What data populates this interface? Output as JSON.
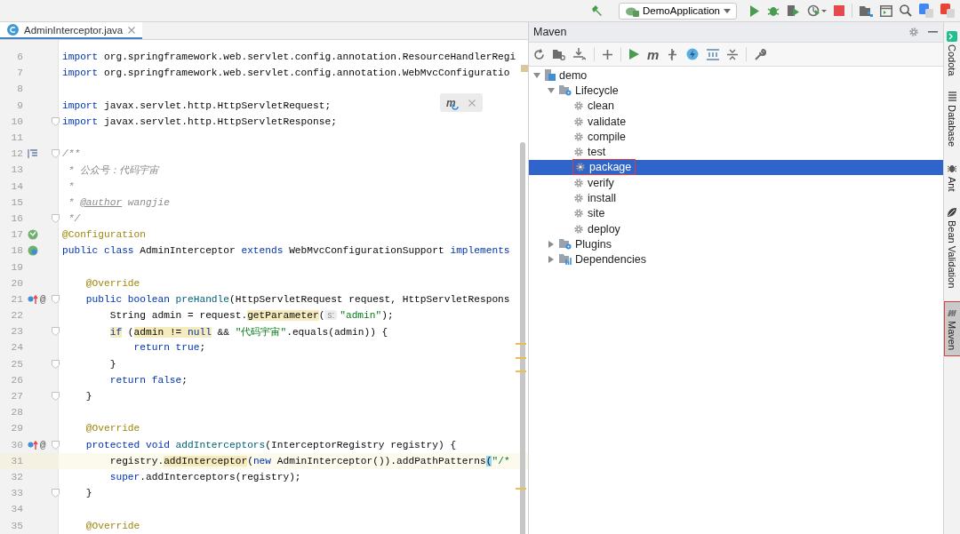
{
  "toolbar": {
    "run_config": "DemoApplication"
  },
  "editor": {
    "tabs": [
      {
        "label": "AdminInterceptor.java",
        "selected": true
      }
    ],
    "popup_label": "m",
    "lines": [
      {
        "number": "6",
        "kind": "plain",
        "current": false,
        "fold": false,
        "tokens": [
          {
            "text": "import",
            "kind": "kw",
            "highlighted": false
          },
          {
            "text": " org.springframework.web.servlet.config.annotation.ResourceHandlerRegi",
            "kind": "plain",
            "highlighted": false
          }
        ]
      },
      {
        "number": "7",
        "kind": "plain",
        "current": false,
        "fold": false,
        "tokens": [
          {
            "text": "import",
            "kind": "kw",
            "highlighted": false
          },
          {
            "text": " org.springframework.web.servlet.config.annotation.WebMvcConfiguratio",
            "kind": "plain",
            "highlighted": false
          }
        ]
      },
      {
        "number": "8",
        "kind": "plain",
        "current": false,
        "fold": false
      },
      {
        "number": "9",
        "kind": "plain",
        "current": false,
        "fold": false,
        "tokens": [
          {
            "text": "import",
            "kind": "kw",
            "highlighted": false
          },
          {
            "text": " javax.servlet.http.HttpServletRequest;",
            "kind": "plain",
            "highlighted": false
          }
        ]
      },
      {
        "number": "10",
        "kind": "plain",
        "current": false,
        "fold": true,
        "tokens": [
          {
            "text": "import",
            "kind": "kw",
            "highlighted": false
          },
          {
            "text": " javax.servlet.http.HttpServletResponse;",
            "kind": "plain",
            "highlighted": false
          }
        ]
      },
      {
        "number": "11",
        "kind": "plain",
        "current": false,
        "fold": false
      },
      {
        "number": "12",
        "kind": "doc",
        "current": false,
        "fold": true,
        "tokens": [
          {
            "text": "/**",
            "kind": "comment",
            "highlighted": false
          }
        ]
      },
      {
        "number": "13",
        "kind": "plain",
        "current": false,
        "fold": false,
        "tokens": [
          {
            "text": " * 公众号：代码宇宙",
            "kind": "comment",
            "highlighted": false
          }
        ]
      },
      {
        "number": "14",
        "kind": "plain",
        "current": false,
        "fold": false,
        "tokens": [
          {
            "text": " *",
            "kind": "comment",
            "highlighted": false
          }
        ]
      },
      {
        "number": "15",
        "kind": "plain",
        "current": false,
        "fold": false,
        "tokens": [
          {
            "text": " * ",
            "kind": "comment",
            "highlighted": false
          },
          {
            "text": "@author",
            "kind": "doctag",
            "highlighted": false
          },
          {
            "text": " wangjie",
            "kind": "comment",
            "highlighted": false
          }
        ]
      },
      {
        "number": "16",
        "kind": "plain",
        "current": false,
        "fold": true,
        "tokens": [
          {
            "text": " */",
            "kind": "comment",
            "highlighted": false
          }
        ]
      },
      {
        "number": "17",
        "kind": "bean",
        "current": false,
        "fold": false,
        "tokens": [
          {
            "text": "@Configuration",
            "kind": "ann",
            "highlighted": false
          }
        ]
      },
      {
        "number": "18",
        "kind": "spring",
        "current": false,
        "fold": false,
        "tokens": [
          {
            "text": "public class",
            "kind": "kw",
            "highlighted": false
          },
          {
            "text": " AdminInterceptor ",
            "kind": "plain",
            "highlighted": false
          },
          {
            "text": "extends",
            "kind": "kw",
            "highlighted": false
          },
          {
            "text": " WebMvcConfigurationSupport ",
            "kind": "plain",
            "highlighted": false
          },
          {
            "text": "implements",
            "kind": "kw",
            "highlighted": false
          }
        ]
      },
      {
        "number": "19",
        "kind": "plain",
        "current": false,
        "fold": false
      },
      {
        "number": "20",
        "kind": "plain",
        "current": false,
        "fold": false,
        "tokens": [
          {
            "text": "    @Override",
            "kind": "ann",
            "highlighted": false
          }
        ]
      },
      {
        "number": "21",
        "kind": "override",
        "current": false,
        "fold": true,
        "gutter_text": "@",
        "tokens": [
          {
            "text": "    public boolean",
            "kind": "kw",
            "highlighted": false
          },
          {
            "text": " preHandle",
            "kind": "method",
            "highlighted": false
          },
          {
            "text": "(HttpServletRequest request, HttpServletRespons",
            "kind": "plain",
            "highlighted": false
          }
        ]
      },
      {
        "number": "22",
        "kind": "plain",
        "current": false,
        "fold": false,
        "tokens": [
          {
            "text": "        String admin = request.",
            "kind": "plain",
            "highlighted": false
          },
          {
            "text": "getParameter",
            "kind": "plain",
            "highlighted": true
          },
          {
            "text": "(",
            "kind": "plain",
            "highlighted": false
          },
          {
            "text": "s:",
            "kind": "hint",
            "highlighted": false
          },
          {
            "text": "\"admin\"",
            "kind": "str",
            "highlighted": false
          },
          {
            "text": ");",
            "kind": "plain",
            "highlighted": false
          }
        ]
      },
      {
        "number": "23",
        "kind": "plain",
        "current": false,
        "fold": true,
        "tokens": [
          {
            "text": "        if",
            "kind": "kw",
            "highlighted": true
          },
          {
            "text": " (",
            "kind": "plain",
            "highlighted": false
          },
          {
            "text": "admin != ",
            "kind": "plain",
            "highlighted": true
          },
          {
            "text": "null",
            "kind": "kw",
            "highlighted": true
          },
          {
            "text": " && ",
            "kind": "plain",
            "highlighted": false
          },
          {
            "text": "\"代码宇宙\"",
            "kind": "str",
            "highlighted": false
          },
          {
            "text": ".equals(admin)) {",
            "kind": "plain",
            "highlighted": false
          }
        ]
      },
      {
        "number": "24",
        "kind": "plain",
        "current": false,
        "fold": false,
        "tokens": [
          {
            "text": "            return true",
            "kind": "kw",
            "highlighted": false
          },
          {
            "text": ";",
            "kind": "plain",
            "highlighted": false
          }
        ]
      },
      {
        "number": "25",
        "kind": "plain",
        "current": false,
        "fold": true,
        "tokens": [
          {
            "text": "        }",
            "kind": "plain",
            "highlighted": false
          }
        ]
      },
      {
        "number": "26",
        "kind": "plain",
        "current": false,
        "fold": false,
        "tokens": [
          {
            "text": "        return false",
            "kind": "kw",
            "highlighted": false
          },
          {
            "text": ";",
            "kind": "plain",
            "highlighted": false
          }
        ]
      },
      {
        "number": "27",
        "kind": "plain",
        "current": false,
        "fold": true,
        "tokens": [
          {
            "text": "    }",
            "kind": "plain",
            "highlighted": false
          }
        ]
      },
      {
        "number": "28",
        "kind": "plain",
        "current": false,
        "fold": false
      },
      {
        "number": "29",
        "kind": "plain",
        "current": false,
        "fold": false,
        "tokens": [
          {
            "text": "    @Override",
            "kind": "ann",
            "highlighted": false
          }
        ]
      },
      {
        "number": "30",
        "kind": "override",
        "current": false,
        "fold": true,
        "gutter_text": "@",
        "tokens": [
          {
            "text": "    protected void",
            "kind": "kw",
            "highlighted": false
          },
          {
            "text": " addInterceptors",
            "kind": "method",
            "highlighted": false
          },
          {
            "text": "(InterceptorRegistry registry) {",
            "kind": "plain",
            "highlighted": false
          }
        ]
      },
      {
        "number": "31",
        "kind": "plain",
        "current": true,
        "fold": false,
        "tokens": [
          {
            "text": "        registry.",
            "kind": "plain",
            "highlighted": false
          },
          {
            "text": "addInterceptor",
            "kind": "plain",
            "highlighted": true
          },
          {
            "text": "(",
            "kind": "plain",
            "highlighted": false
          },
          {
            "text": "new",
            "kind": "kw",
            "highlighted": false
          },
          {
            "text": " AdminInterceptor()).addPathPatterns",
            "kind": "plain",
            "highlighted": false
          },
          {
            "text": "(",
            "kind": "brace",
            "highlighted": true
          },
          {
            "text": "\"/*",
            "kind": "str",
            "highlighted": false
          }
        ]
      },
      {
        "number": "32",
        "kind": "plain",
        "current": false,
        "fold": false,
        "tokens": [
          {
            "text": "        super",
            "kind": "kw",
            "highlighted": false
          },
          {
            "text": ".addInterceptors(registry);",
            "kind": "plain",
            "highlighted": false
          }
        ]
      },
      {
        "number": "33",
        "kind": "plain",
        "current": false,
        "fold": true,
        "tokens": [
          {
            "text": "    }",
            "kind": "plain",
            "highlighted": false
          }
        ]
      },
      {
        "number": "34",
        "kind": "plain",
        "current": false,
        "fold": false
      },
      {
        "number": "35",
        "kind": "plain",
        "current": false,
        "fold": false,
        "tokens": [
          {
            "text": "    @Override",
            "kind": "ann",
            "highlighted": false
          }
        ]
      }
    ]
  },
  "maven": {
    "title": "Maven",
    "execute_label": "m",
    "tree": [
      {
        "label": "demo",
        "kind": "project",
        "expanded": true,
        "selected": false,
        "annotated": false,
        "children": [
          {
            "label": "Lifecycle",
            "kind": "lifecycle",
            "expanded": true,
            "selected": false,
            "annotated": false,
            "children": [
              {
                "label": "clean",
                "kind": "goal",
                "selected": false,
                "annotated": false
              },
              {
                "label": "validate",
                "kind": "goal",
                "selected": false,
                "annotated": false
              },
              {
                "label": "compile",
                "kind": "goal",
                "selected": false,
                "annotated": false
              },
              {
                "label": "test",
                "kind": "goal",
                "selected": false,
                "annotated": false
              },
              {
                "label": "package",
                "kind": "goal",
                "selected": true,
                "annotated": true
              },
              {
                "label": "verify",
                "kind": "goal",
                "selected": false,
                "annotated": false
              },
              {
                "label": "install",
                "kind": "goal",
                "selected": false,
                "annotated": false
              },
              {
                "label": "site",
                "kind": "goal",
                "selected": false,
                "annotated": false
              },
              {
                "label": "deploy",
                "kind": "goal",
                "selected": false,
                "annotated": false
              }
            ]
          },
          {
            "label": "Plugins",
            "kind": "plugins",
            "expanded": false,
            "selected": false,
            "annotated": false
          },
          {
            "label": "Dependencies",
            "kind": "dependencies",
            "expanded": false,
            "selected": false,
            "annotated": false
          }
        ]
      }
    ]
  },
  "side_tabs": [
    {
      "label": "Codota",
      "kind": "codota",
      "selected": false,
      "annotated": false
    },
    {
      "label": "Database",
      "kind": "database",
      "selected": false,
      "annotated": false
    },
    {
      "label": "Ant",
      "kind": "ant",
      "selected": false,
      "annotated": false
    },
    {
      "label": "Bean Validation",
      "kind": "bean",
      "selected": false,
      "annotated": false
    },
    {
      "label": "Maven",
      "kind": "maven",
      "selected": true,
      "annotated": true
    }
  ]
}
